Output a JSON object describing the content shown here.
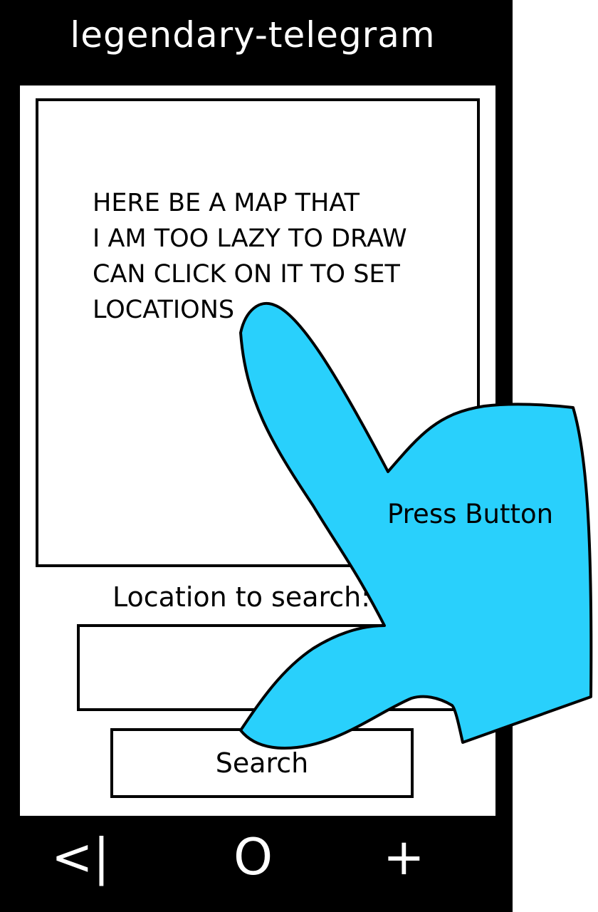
{
  "app": {
    "title": "legendary-telegram"
  },
  "map": {
    "placeholder_text": "HERE BE A MAP THAT\nI AM TOO LAZY TO DRAW\nCAN CLICK ON IT TO SET\nLOCATIONS"
  },
  "search": {
    "label": "Location to search:",
    "input_value": "",
    "button_label": "Search"
  },
  "nav": {
    "back_label": "<|",
    "home_label": "O",
    "add_label": "+"
  },
  "annotation": {
    "text": "Press Button",
    "hand_color": "#29d0fc"
  }
}
